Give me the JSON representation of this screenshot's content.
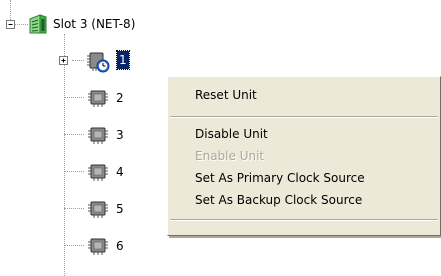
{
  "tree": {
    "slot": {
      "label": "Slot 3 (NET-8)",
      "icon": "slot-card-icon",
      "expanded": true
    },
    "units": [
      {
        "label": "1",
        "icon": "chip-clock-icon",
        "selected": true,
        "has_children": true
      },
      {
        "label": "2",
        "icon": "chip-icon"
      },
      {
        "label": "3",
        "icon": "chip-icon"
      },
      {
        "label": "4",
        "icon": "chip-icon"
      },
      {
        "label": "5",
        "icon": "chip-icon"
      },
      {
        "label": "6",
        "icon": "chip-icon"
      }
    ]
  },
  "context_menu": {
    "items": [
      {
        "label": "Reset Unit",
        "enabled": true
      },
      {
        "label": "Disable Unit",
        "enabled": true
      },
      {
        "label": "Enable Unit",
        "enabled": false
      },
      {
        "label": "Set As Primary Clock Source",
        "enabled": true
      },
      {
        "label": "Set As Backup Clock Source",
        "enabled": true
      }
    ]
  },
  "colors": {
    "selection_bg": "#0a246a",
    "menu_bg": "#ece9d8",
    "disabled_text": "#aca899",
    "tree_lines": "#a0a0a0",
    "slot_icon_green": "#3cb043",
    "chip_body": "#6e6e6e"
  }
}
